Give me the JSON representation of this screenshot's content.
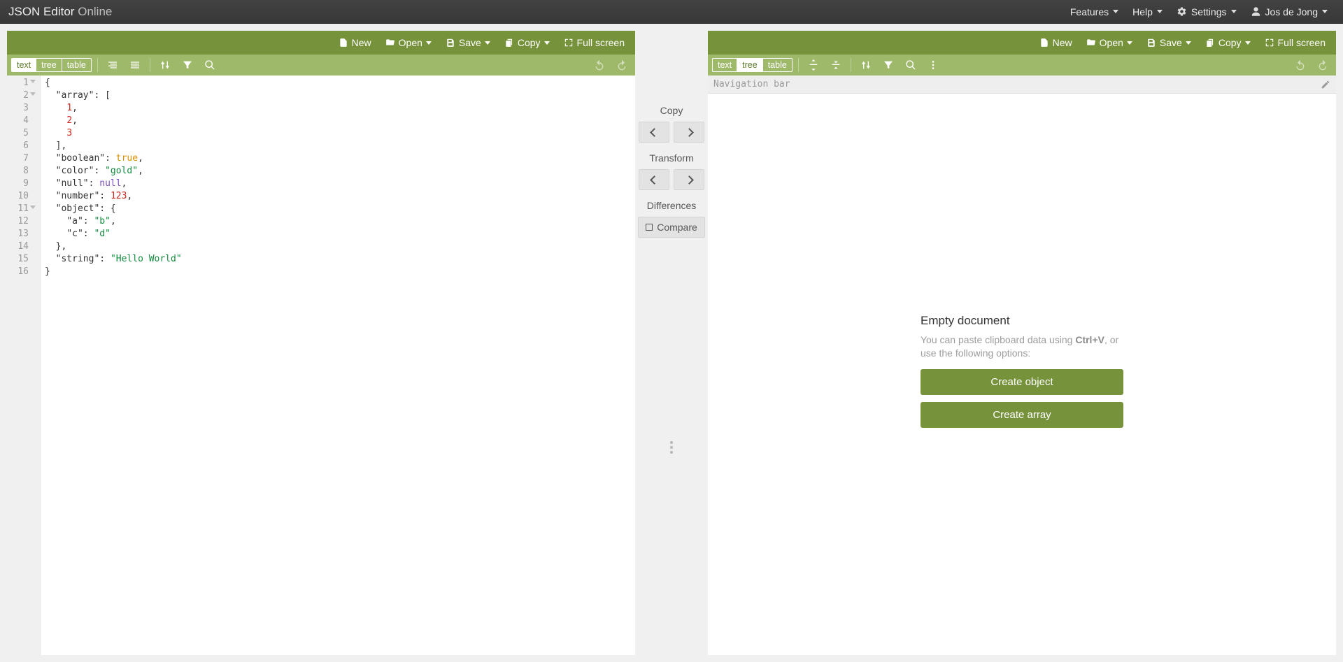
{
  "header": {
    "title_bold": "JSON Editor",
    "title_light": "Online",
    "menus": {
      "features": "Features",
      "help": "Help",
      "settings": "Settings",
      "user": "Jos de Jong"
    }
  },
  "panel_toolbar": {
    "new": "New",
    "open": "Open",
    "save": "Save",
    "copy": "Copy",
    "fullscreen": "Full screen"
  },
  "modes": {
    "text": "text",
    "tree": "tree",
    "table": "table"
  },
  "left_editor": {
    "active_mode": "text",
    "lines": [
      {
        "n": 1,
        "fold": true,
        "tokens": [
          [
            "punc",
            "{"
          ]
        ]
      },
      {
        "n": 2,
        "fold": true,
        "tokens": [
          [
            "ind",
            "  "
          ],
          [
            "key",
            "\"array\""
          ],
          [
            "punc",
            ": ["
          ]
        ]
      },
      {
        "n": 3,
        "tokens": [
          [
            "ind",
            "    "
          ],
          [
            "num",
            "1"
          ],
          [
            "punc",
            ","
          ]
        ]
      },
      {
        "n": 4,
        "tokens": [
          [
            "ind",
            "    "
          ],
          [
            "num",
            "2"
          ],
          [
            "punc",
            ","
          ]
        ]
      },
      {
        "n": 5,
        "tokens": [
          [
            "ind",
            "    "
          ],
          [
            "num",
            "3"
          ]
        ]
      },
      {
        "n": 6,
        "tokens": [
          [
            "ind",
            "  "
          ],
          [
            "punc",
            "],"
          ]
        ]
      },
      {
        "n": 7,
        "tokens": [
          [
            "ind",
            "  "
          ],
          [
            "key",
            "\"boolean\""
          ],
          [
            "punc",
            ": "
          ],
          [
            "bool",
            "true"
          ],
          [
            "punc",
            ","
          ]
        ]
      },
      {
        "n": 8,
        "tokens": [
          [
            "ind",
            "  "
          ],
          [
            "key",
            "\"color\""
          ],
          [
            "punc",
            ": "
          ],
          [
            "str",
            "\"gold\""
          ],
          [
            "punc",
            ","
          ]
        ]
      },
      {
        "n": 9,
        "tokens": [
          [
            "ind",
            "  "
          ],
          [
            "key",
            "\"null\""
          ],
          [
            "punc",
            ": "
          ],
          [
            "null",
            "null"
          ],
          [
            "punc",
            ","
          ]
        ]
      },
      {
        "n": 10,
        "tokens": [
          [
            "ind",
            "  "
          ],
          [
            "key",
            "\"number\""
          ],
          [
            "punc",
            ": "
          ],
          [
            "num",
            "123"
          ],
          [
            "punc",
            ","
          ]
        ]
      },
      {
        "n": 11,
        "fold": true,
        "tokens": [
          [
            "ind",
            "  "
          ],
          [
            "key",
            "\"object\""
          ],
          [
            "punc",
            ": {"
          ]
        ]
      },
      {
        "n": 12,
        "tokens": [
          [
            "ind",
            "    "
          ],
          [
            "key",
            "\"a\""
          ],
          [
            "punc",
            ": "
          ],
          [
            "str",
            "\"b\""
          ],
          [
            "punc",
            ","
          ]
        ]
      },
      {
        "n": 13,
        "tokens": [
          [
            "ind",
            "    "
          ],
          [
            "key",
            "\"c\""
          ],
          [
            "punc",
            ": "
          ],
          [
            "str",
            "\"d\""
          ]
        ]
      },
      {
        "n": 14,
        "tokens": [
          [
            "ind",
            "  "
          ],
          [
            "punc",
            "},"
          ]
        ]
      },
      {
        "n": 15,
        "tokens": [
          [
            "ind",
            "  "
          ],
          [
            "key",
            "\"string\""
          ],
          [
            "punc",
            ": "
          ],
          [
            "str",
            "\"Hello World\""
          ]
        ]
      },
      {
        "n": 16,
        "tokens": [
          [
            "punc",
            "}"
          ]
        ]
      }
    ]
  },
  "middle": {
    "copy": "Copy",
    "transform": "Transform",
    "differences": "Differences",
    "compare": "Compare"
  },
  "right_editor": {
    "active_mode": "tree",
    "nav_placeholder": "Navigation bar",
    "empty_title": "Empty document",
    "empty_text_pre": "You can paste clipboard data using ",
    "empty_text_key": "Ctrl+V",
    "empty_text_post": ", or use the following options:",
    "create_object": "Create object",
    "create_array": "Create array"
  }
}
